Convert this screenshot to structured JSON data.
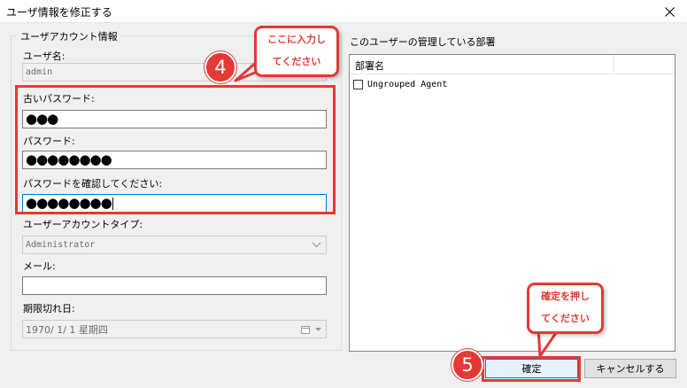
{
  "window": {
    "title": "ユーザ情報を修正する",
    "close_icon": "close-icon"
  },
  "user_account": {
    "group_title": "ユーザアカウント情報",
    "username_label": "ユーザ名:",
    "username_value": "admin",
    "old_password_label": "古いパスワード:",
    "old_password_dots": "●●●",
    "password_label": "パスワード:",
    "password_dots": "●●●●●●●●",
    "confirm_password_label": "パスワードを確認してください:",
    "confirm_password_dots": "●●●●●●●●",
    "account_type_label": "ユーザーアカウントタイプ:",
    "account_type_value": "Administrator",
    "email_label": "メール:",
    "email_value": "",
    "expiry_label": "期限切れ日:",
    "expiry_value": "1970/ 1/ 1 星期四"
  },
  "departments": {
    "title": "このユーザーの管理している部署",
    "column_header": "部署名",
    "items": [
      {
        "label": "Ungrouped Agent",
        "checked": false
      }
    ]
  },
  "buttons": {
    "ok": "確定",
    "cancel": "キャンセルする"
  },
  "annotations": {
    "step4_number": "4",
    "step4_line1": "ここに入力し",
    "step4_line2": "てください",
    "step5_number": "5",
    "step5_line1": "確定を押し",
    "step5_line2": "てください",
    "accent_color": "#e53935"
  }
}
